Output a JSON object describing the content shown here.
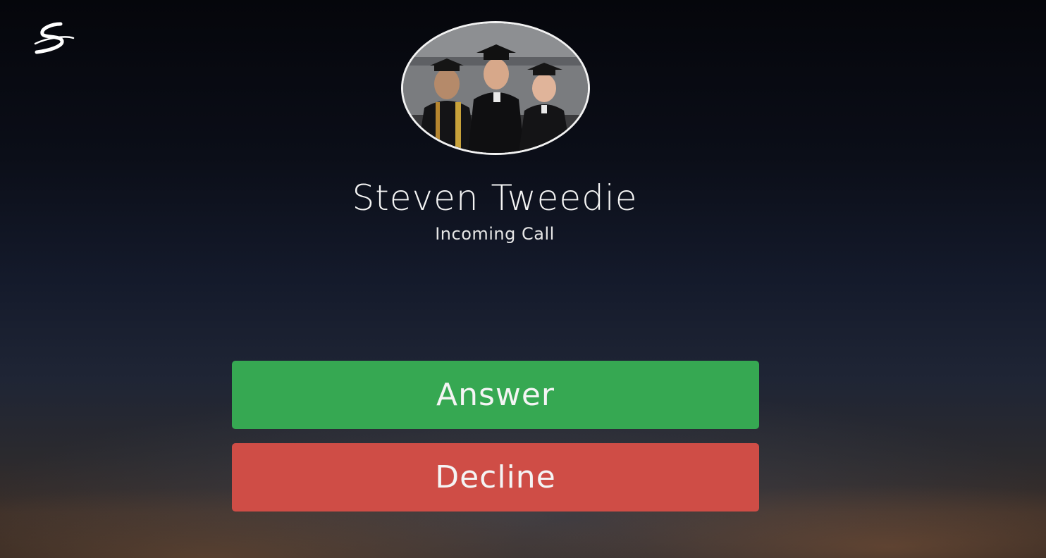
{
  "logo": {
    "icon": "s-swoosh-logo-icon"
  },
  "caller": {
    "name": "Steven Tweedie",
    "status": "Incoming Call",
    "avatar": "graduates-photo"
  },
  "actions": {
    "answer_label": "Answer",
    "decline_label": "Decline"
  },
  "colors": {
    "answer": "#36a852",
    "decline": "#cf4d46",
    "text": "#f4f4f4"
  }
}
